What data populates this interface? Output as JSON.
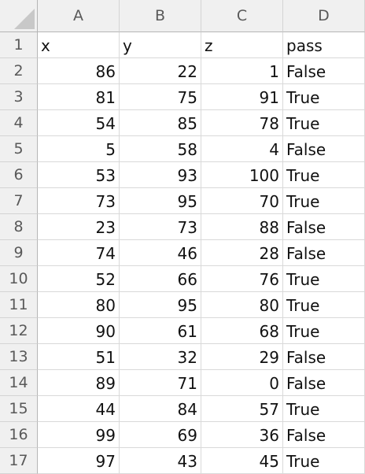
{
  "columns": [
    "A",
    "B",
    "C",
    "D"
  ],
  "rows": [
    [
      "x",
      "y",
      "z",
      "pass"
    ],
    [
      "86",
      "22",
      "1",
      "False"
    ],
    [
      "81",
      "75",
      "91",
      "True"
    ],
    [
      "54",
      "85",
      "78",
      "True"
    ],
    [
      "5",
      "58",
      "4",
      "False"
    ],
    [
      "53",
      "93",
      "100",
      "True"
    ],
    [
      "73",
      "95",
      "70",
      "True"
    ],
    [
      "23",
      "73",
      "88",
      "False"
    ],
    [
      "74",
      "46",
      "28",
      "False"
    ],
    [
      "52",
      "66",
      "76",
      "True"
    ],
    [
      "80",
      "95",
      "80",
      "True"
    ],
    [
      "90",
      "61",
      "68",
      "True"
    ],
    [
      "51",
      "32",
      "29",
      "False"
    ],
    [
      "89",
      "71",
      "0",
      "False"
    ],
    [
      "44",
      "84",
      "57",
      "True"
    ],
    [
      "99",
      "69",
      "36",
      "False"
    ],
    [
      "97",
      "43",
      "45",
      "True"
    ]
  ],
  "row_numbers": [
    "1",
    "2",
    "3",
    "4",
    "5",
    "6",
    "7",
    "8",
    "9",
    "10",
    "11",
    "12",
    "13",
    "14",
    "15",
    "16",
    "17"
  ]
}
